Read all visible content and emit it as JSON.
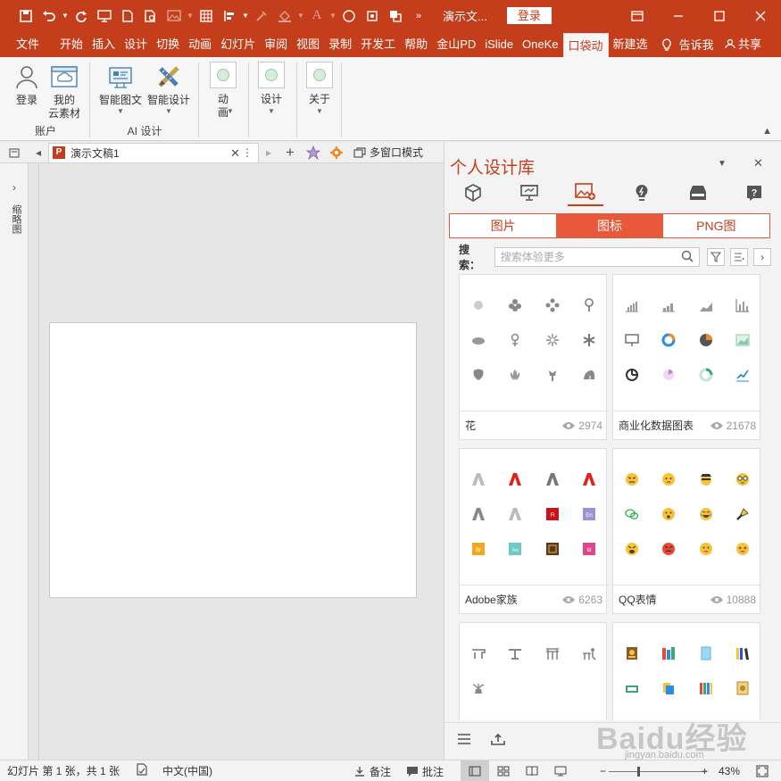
{
  "titlebar": {
    "doc_title": "演示文...",
    "login_label": "登录",
    "colors": {
      "brand": "#c43e1c"
    }
  },
  "ribbon_tabs": [
    {
      "label": "文件"
    },
    {
      "label": "开始"
    },
    {
      "label": "插入"
    },
    {
      "label": "设计"
    },
    {
      "label": "切换"
    },
    {
      "label": "动画"
    },
    {
      "label": "幻灯片"
    },
    {
      "label": "审阅"
    },
    {
      "label": "视图"
    },
    {
      "label": "录制"
    },
    {
      "label": "开发工"
    },
    {
      "label": "帮助"
    },
    {
      "label": "金山PD"
    },
    {
      "label": "iSlide"
    },
    {
      "label": "OneKe"
    },
    {
      "label": "口袋动"
    },
    {
      "label": "新建选"
    }
  ],
  "ribbon_extra": {
    "tell_me": "告诉我",
    "share": "共享"
  },
  "ribbon": {
    "account_group": {
      "name": "账户",
      "login": "登录",
      "my_assets_line1": "我的",
      "my_assets_line2": "云素材"
    },
    "ai_group": {
      "name": "AI 设计",
      "smart_graphic": "智能图文",
      "smart_design": "智能设计"
    },
    "animation_line1": "动",
    "animation_line2": "画",
    "design": "设计",
    "about": "关于"
  },
  "doctabs": {
    "doc_name": "演示文稿1",
    "multi_window": "多窗口模式"
  },
  "leftrail": {
    "label": "缩略图"
  },
  "panel": {
    "title": "个人设计库",
    "segments": [
      {
        "label": "图片",
        "active": false
      },
      {
        "label": "图标",
        "active": true
      },
      {
        "label": "PNG图",
        "active": false
      }
    ],
    "search_label": "搜索：",
    "search_placeholder": "搜索体验更多",
    "cards": [
      {
        "name": "花",
        "views": "2974"
      },
      {
        "name": "商业化数据图表",
        "views": "21678"
      },
      {
        "name": "Adobe家族",
        "views": "6263"
      },
      {
        "name": "QQ表情",
        "views": "10888"
      },
      {
        "name": "",
        "views": ""
      },
      {
        "name": "",
        "views": ""
      }
    ]
  },
  "statusbar": {
    "slide_info": "幻灯片 第 1 张，共 1 张",
    "language": "中文(中国)",
    "notes": "备注",
    "comments": "批注",
    "zoom": "43%"
  },
  "watermark": {
    "text": "Baidu经验",
    "url": "jingyan.baidu.com"
  }
}
